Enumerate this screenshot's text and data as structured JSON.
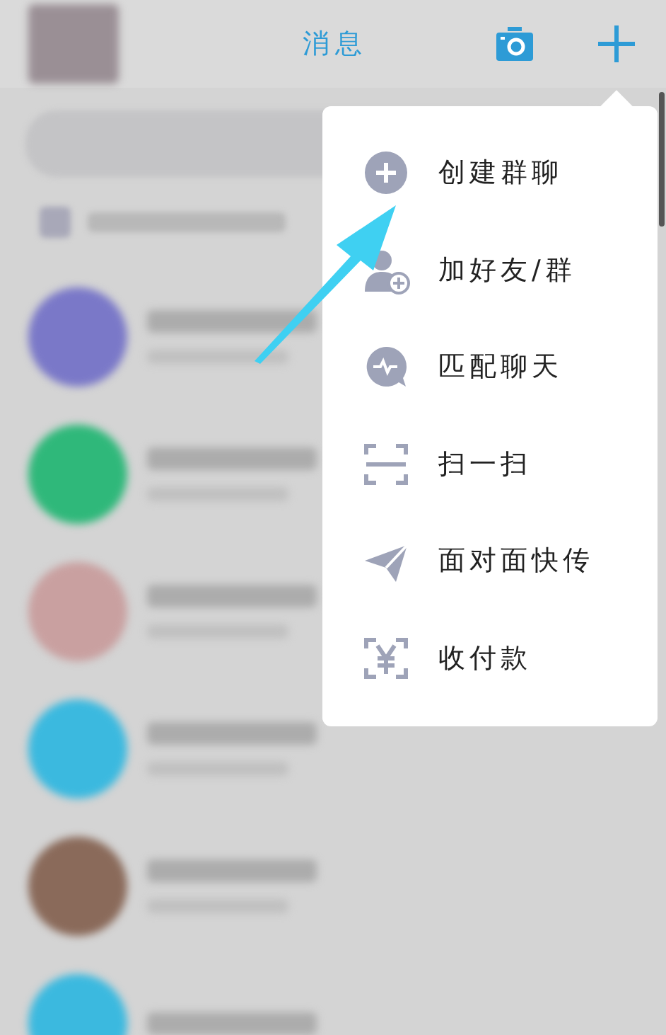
{
  "header": {
    "title": "消息"
  },
  "conversations": [
    {
      "color": "#7a78c8"
    },
    {
      "color": "#2fb87a"
    },
    {
      "color": "#c9a0a0"
    },
    {
      "color": "#3bb9df"
    },
    {
      "color": "#8a6a5a"
    },
    {
      "color": "#3bb9df"
    }
  ],
  "menu": {
    "items": [
      {
        "kind": "create-group",
        "label": "创建群聊"
      },
      {
        "kind": "add-friend",
        "label": "加好友/群"
      },
      {
        "kind": "match-chat",
        "label": "匹配聊天"
      },
      {
        "kind": "scan",
        "label": "扫一扫"
      },
      {
        "kind": "send",
        "label": "面对面快传"
      },
      {
        "kind": "pay",
        "label": "收付款"
      }
    ]
  }
}
